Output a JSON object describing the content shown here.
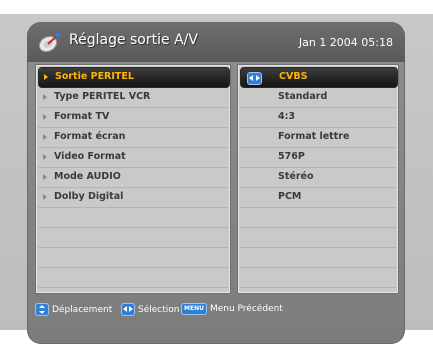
{
  "header": {
    "title": "Réglage sortie A/V",
    "datetime": "Jan 1 2004 05:18",
    "icon": "satellite-dish-icon"
  },
  "menu": {
    "items": [
      {
        "label": "Sortie PERITEL",
        "value": "CVBS",
        "selected": true
      },
      {
        "label": "Type PERITEL VCR",
        "value": "Standard",
        "selected": false
      },
      {
        "label": "Format TV",
        "value": "4:3",
        "selected": false
      },
      {
        "label": "Format écran",
        "value": "Format lettre",
        "selected": false
      },
      {
        "label": "Video Format",
        "value": "576P",
        "selected": false
      },
      {
        "label": "Mode AUDIO",
        "value": "Stéréo",
        "selected": false
      },
      {
        "label": "Dolby Digital",
        "value": "PCM",
        "selected": false
      }
    ]
  },
  "footer": {
    "move_label": "Déplacement",
    "select_label": "Sélection",
    "menu_key": "MENU",
    "back_label": "Menu Précédent"
  },
  "colors": {
    "highlight_text": "#ffb400",
    "key_badge": "#2f7fd6",
    "panel_bg": "#c9c9c9"
  }
}
